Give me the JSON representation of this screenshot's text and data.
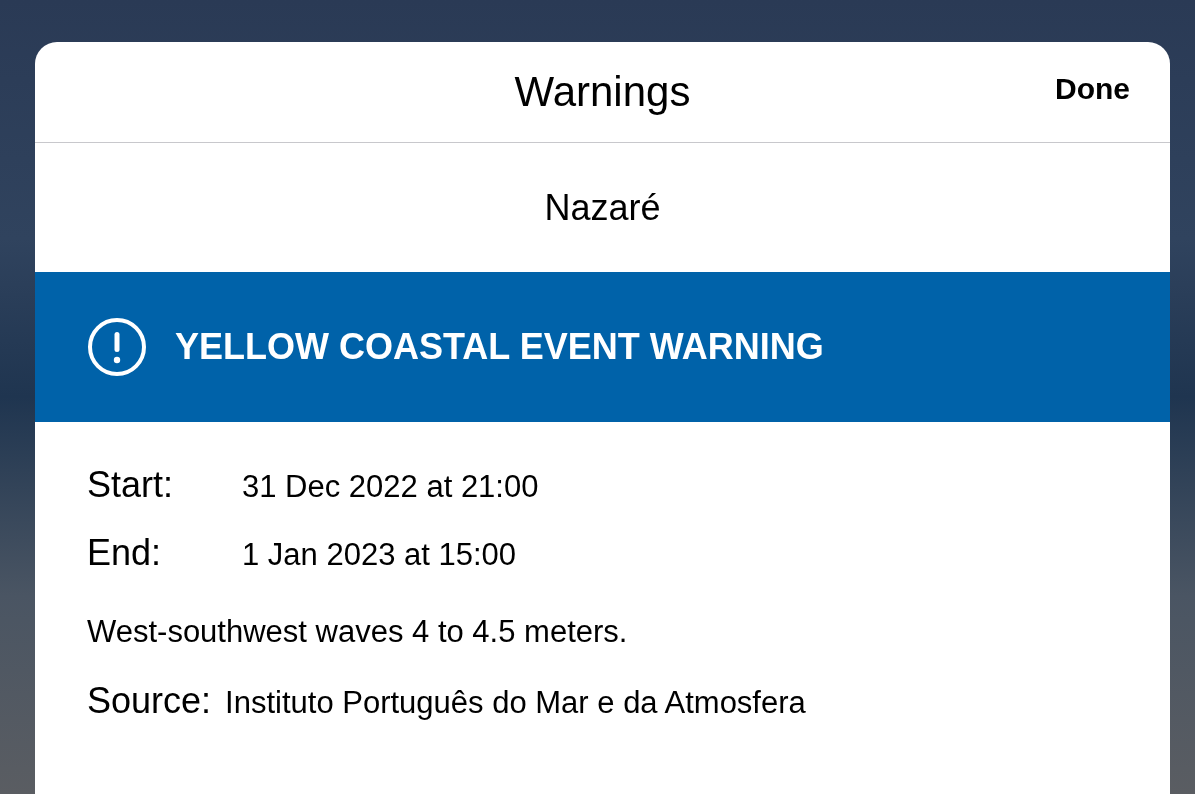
{
  "sheet": {
    "title": "Warnings",
    "done_button": "Done"
  },
  "location": "Nazaré",
  "warning": {
    "title": "YELLOW COASTAL EVENT WARNING",
    "details": [
      {
        "label": "Start:",
        "value": "31 Dec 2022 at 21:00"
      },
      {
        "label": "End:",
        "value": "1 Jan 2023 at 15:00"
      }
    ],
    "description": "West-southwest waves 4 to 4.5 meters.",
    "source": {
      "label": "Source:",
      "value": "Instituto Português do Mar e da Atmosfera"
    }
  }
}
